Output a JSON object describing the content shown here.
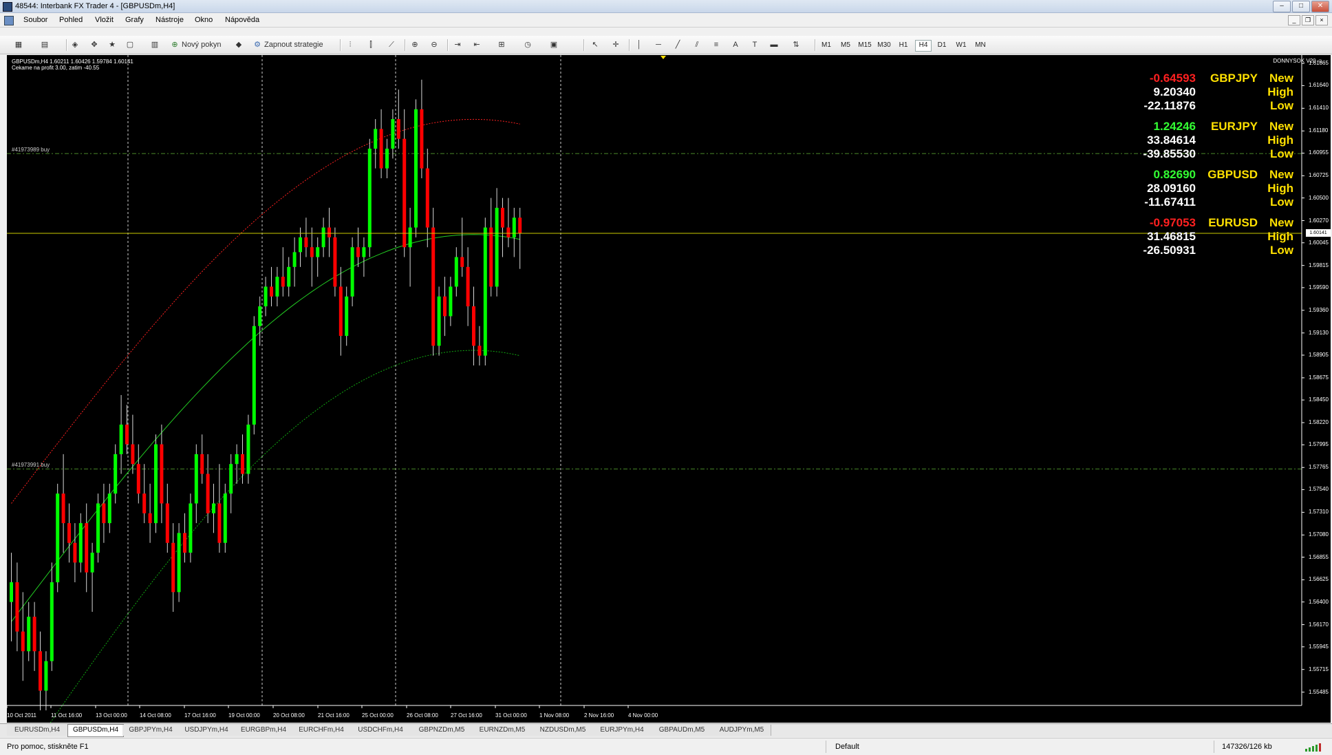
{
  "window": {
    "title": "48544: Interbank FX Trader 4 - [GBPUSDm,H4]"
  },
  "menu": [
    "Soubor",
    "Pohled",
    "Vložit",
    "Grafy",
    "Nástroje",
    "Okno",
    "Nápověda"
  ],
  "toolbar": {
    "new_order_label": "Nový pokyn",
    "strategies_label": "Zapnout strategie",
    "timeframes": [
      "M1",
      "M5",
      "M15",
      "M30",
      "H1",
      "H4",
      "D1",
      "W1",
      "MN"
    ],
    "active_timeframe": "H4"
  },
  "chart": {
    "symbol_info": "GBPUSDm,H4  1.60211 1.60426 1.59784 1.60141",
    "comment": "Cekame na profit 3.00, zatim -40.55",
    "ea_label": "DONNYSOK V20 ☺",
    "current_price": "1.60141",
    "orders": [
      {
        "label": "#41973989 buy",
        "price": 1.6095
      },
      {
        "label": "#41973991 buy",
        "price": 1.5775
      }
    ],
    "price_axis": [
      "1.61865",
      "1.61640",
      "1.61410",
      "1.61180",
      "1.60955",
      "1.60725",
      "1.60500",
      "1.60270",
      "1.60045",
      "1.59815",
      "1.59590",
      "1.59360",
      "1.59130",
      "1.58905",
      "1.58675",
      "1.58450",
      "1.58220",
      "1.57995",
      "1.57765",
      "1.57540",
      "1.57310",
      "1.57080",
      "1.56855",
      "1.56625",
      "1.56400",
      "1.56170",
      "1.55945",
      "1.55715",
      "1.55485"
    ],
    "time_axis": [
      "10 Oct 2011",
      "11 Oct 16:00",
      "13 Oct 00:00",
      "14 Oct 08:00",
      "17 Oct 16:00",
      "19 Oct 00:00",
      "20 Oct 08:00",
      "21 Oct 16:00",
      "25 Oct 00:00",
      "26 Oct 08:00",
      "27 Oct 16:00",
      "31 Oct 00:00",
      "1 Nov 08:00",
      "2 Nov 16:00",
      "4 Nov 00:00"
    ],
    "colors": {
      "background": "#000000",
      "bull": "#00ff00",
      "bear": "#ff0000",
      "ma_mid": "#22cc22",
      "band_upper": "#ff2020",
      "band_lower": "#11aa11",
      "price_line": "#cccc00",
      "order_line": "#4a8a2a"
    }
  },
  "dashboard": [
    {
      "pair": "GBPJPY",
      "new": "-0.64593",
      "new_color": "#ff2020",
      "high": "9.20340",
      "low": "-22.11876"
    },
    {
      "pair": "EURJPY",
      "new": "1.24246",
      "new_color": "#33ff33",
      "high": "33.84614",
      "low": "-39.85530"
    },
    {
      "pair": "GBPUSD",
      "new": "0.82690",
      "new_color": "#33ff33",
      "high": "28.09160",
      "low": "-11.67411"
    },
    {
      "pair": "EURUSD",
      "new": "-0.97053",
      "new_color": "#ff2020",
      "high": "31.46815",
      "low": "-26.50931"
    }
  ],
  "dashboard_labels": {
    "new": "New",
    "high": "High",
    "low": "Low"
  },
  "tabs": [
    "EURUSDm,H4",
    "GBPUSDm,H4",
    "GBPJPYm,H4",
    "USDJPYm,H4",
    "EURGBPm,H4",
    "EURCHFm,H4",
    "USDCHFm,H4",
    "GBPNZDm,M5",
    "EURNZDm,M5",
    "NZDUSDm,M5",
    "EURJPYm,H4",
    "GBPAUDm,M5",
    "AUDJPYm,M5"
  ],
  "active_tab": "GBPUSDm,H4",
  "status": {
    "help": "Pro pomoc, stiskněte F1",
    "profile": "Default",
    "traffic": "147326/126 kb"
  },
  "chart_data": {
    "type": "candlestick",
    "symbol": "GBPUSDm",
    "timeframe": "H4",
    "ylim": [
      1.5535,
      1.6195
    ],
    "ohlc": [
      [
        1.564,
        1.569,
        1.56,
        1.566
      ],
      [
        1.566,
        1.568,
        1.559,
        1.561
      ],
      [
        1.561,
        1.565,
        1.556,
        1.559
      ],
      [
        1.559,
        1.564,
        1.558,
        1.5625
      ],
      [
        1.5625,
        1.564,
        1.557,
        1.559
      ],
      [
        1.559,
        1.561,
        1.553,
        1.555
      ],
      [
        1.555,
        1.559,
        1.553,
        1.558
      ],
      [
        1.558,
        1.568,
        1.557,
        1.566
      ],
      [
        1.566,
        1.576,
        1.565,
        1.575
      ],
      [
        1.575,
        1.579,
        1.569,
        1.572
      ],
      [
        1.572,
        1.574,
        1.568,
        1.57
      ],
      [
        1.57,
        1.572,
        1.566,
        1.568
      ],
      [
        1.568,
        1.573,
        1.567,
        1.572
      ],
      [
        1.572,
        1.574,
        1.565,
        1.567
      ],
      [
        1.567,
        1.57,
        1.563,
        1.569
      ],
      [
        1.569,
        1.575,
        1.568,
        1.574
      ],
      [
        1.574,
        1.576,
        1.57,
        1.572
      ],
      [
        1.572,
        1.576,
        1.571,
        1.575
      ],
      [
        1.575,
        1.58,
        1.574,
        1.579
      ],
      [
        1.579,
        1.585,
        1.577,
        1.582
      ],
      [
        1.582,
        1.584,
        1.579,
        1.58
      ],
      [
        1.58,
        1.583,
        1.577,
        1.578
      ],
      [
        1.578,
        1.58,
        1.574,
        1.575
      ],
      [
        1.575,
        1.578,
        1.572,
        1.573
      ],
      [
        1.573,
        1.576,
        1.57,
        1.572
      ],
      [
        1.572,
        1.581,
        1.571,
        1.58
      ],
      [
        1.58,
        1.582,
        1.572,
        1.574
      ],
      [
        1.574,
        1.576,
        1.569,
        1.57
      ],
      [
        1.57,
        1.572,
        1.563,
        1.565
      ],
      [
        1.565,
        1.572,
        1.564,
        1.571
      ],
      [
        1.571,
        1.573,
        1.568,
        1.569
      ],
      [
        1.569,
        1.575,
        1.568,
        1.574
      ],
      [
        1.574,
        1.58,
        1.572,
        1.579
      ],
      [
        1.579,
        1.581,
        1.576,
        1.577
      ],
      [
        1.577,
        1.579,
        1.572,
        1.573
      ],
      [
        1.573,
        1.576,
        1.571,
        1.574
      ],
      [
        1.574,
        1.578,
        1.569,
        1.57
      ],
      [
        1.57,
        1.576,
        1.569,
        1.575
      ],
      [
        1.575,
        1.579,
        1.573,
        1.578
      ],
      [
        1.578,
        1.58,
        1.576,
        1.579
      ],
      [
        1.579,
        1.581,
        1.576,
        1.577
      ],
      [
        1.577,
        1.583,
        1.576,
        1.582
      ],
      [
        1.582,
        1.593,
        1.581,
        1.592
      ],
      [
        1.592,
        1.595,
        1.59,
        1.594
      ],
      [
        1.594,
        1.597,
        1.593,
        1.596
      ],
      [
        1.596,
        1.598,
        1.594,
        1.595
      ],
      [
        1.595,
        1.598,
        1.594,
        1.597
      ],
      [
        1.597,
        1.6,
        1.595,
        1.596
      ],
      [
        1.596,
        1.599,
        1.595,
        1.598
      ],
      [
        1.598,
        1.601,
        1.596,
        1.5995
      ],
      [
        1.5995,
        1.602,
        1.598,
        1.601
      ],
      [
        1.601,
        1.603,
        1.599,
        1.6
      ],
      [
        1.6,
        1.602,
        1.596,
        1.599
      ],
      [
        1.599,
        1.601,
        1.597,
        1.6
      ],
      [
        1.6,
        1.603,
        1.599,
        1.602
      ],
      [
        1.602,
        1.604,
        1.599,
        1.601
      ],
      [
        1.601,
        1.602,
        1.595,
        1.596
      ],
      [
        1.596,
        1.598,
        1.589,
        1.591
      ],
      [
        1.591,
        1.596,
        1.59,
        1.595
      ],
      [
        1.595,
        1.601,
        1.594,
        1.6
      ],
      [
        1.6,
        1.602,
        1.598,
        1.599
      ],
      [
        1.599,
        1.601,
        1.597,
        1.6
      ],
      [
        1.6,
        1.611,
        1.599,
        1.61
      ],
      [
        1.61,
        1.613,
        1.608,
        1.612
      ],
      [
        1.612,
        1.614,
        1.607,
        1.608
      ],
      [
        1.608,
        1.611,
        1.607,
        1.61
      ],
      [
        1.61,
        1.614,
        1.609,
        1.613
      ],
      [
        1.613,
        1.616,
        1.61,
        1.611
      ],
      [
        1.611,
        1.614,
        1.599,
        1.6
      ],
      [
        1.6,
        1.604,
        1.596,
        1.602
      ],
      [
        1.602,
        1.615,
        1.601,
        1.614
      ],
      [
        1.614,
        1.617,
        1.607,
        1.608
      ],
      [
        1.608,
        1.61,
        1.6,
        1.602
      ],
      [
        1.602,
        1.604,
        1.589,
        1.59
      ],
      [
        1.59,
        1.596,
        1.589,
        1.595
      ],
      [
        1.595,
        1.597,
        1.591,
        1.593
      ],
      [
        1.593,
        1.597,
        1.592,
        1.596
      ],
      [
        1.596,
        1.6,
        1.595,
        1.599
      ],
      [
        1.599,
        1.603,
        1.597,
        1.598
      ],
      [
        1.598,
        1.6,
        1.592,
        1.594
      ],
      [
        1.594,
        1.596,
        1.588,
        1.59
      ],
      [
        1.59,
        1.592,
        1.588,
        1.589
      ],
      [
        1.589,
        1.603,
        1.588,
        1.602
      ],
      [
        1.602,
        1.605,
        1.595,
        1.596
      ],
      [
        1.596,
        1.606,
        1.595,
        1.604
      ],
      [
        1.604,
        1.605,
        1.599,
        1.602
      ],
      [
        1.602,
        1.605,
        1.6,
        1.601
      ],
      [
        1.601,
        1.604,
        1.599,
        1.603
      ],
      [
        1.603,
        1.604,
        1.5978,
        1.6014
      ]
    ],
    "indicators": {
      "upper_band": {
        "start": 1.574,
        "end": 1.6125
      },
      "middle_ma": {
        "start": 1.562,
        "end": 1.6008
      },
      "lower_band": {
        "start": 1.546,
        "end": 1.589
      }
    },
    "grid": false,
    "period_separators": true
  }
}
